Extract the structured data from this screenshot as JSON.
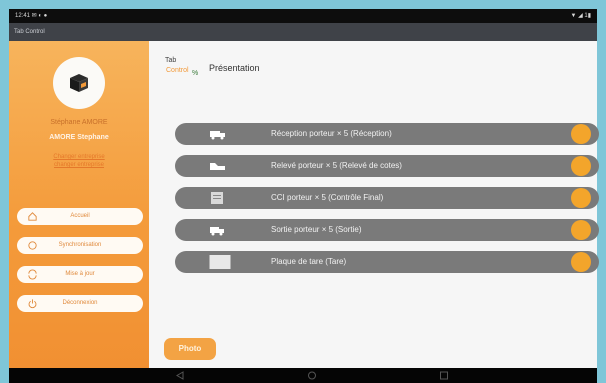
{
  "status_bar": {
    "left": "12:41 ✉ ◐ ●",
    "right": "▼ ◢ 1▮"
  },
  "app_title": "Tab Control",
  "sidebar": {
    "profile_lines": [
      "Stéphane AMORE",
      "AMORE Stephane",
      "Changer entreprise",
      "changer entreprise"
    ],
    "menu": [
      {
        "label": "Accueil",
        "icon": "home-icon"
      },
      {
        "label": "Synchronisation",
        "icon": "sync-icon"
      },
      {
        "label": "Mise à jour",
        "icon": "update-icon"
      },
      {
        "label": "Déconnexion",
        "icon": "power-icon"
      }
    ]
  },
  "header": {
    "brand_tab": "Tab",
    "brand_control": "Control",
    "brand_mark": "%",
    "title": "Présentation"
  },
  "tasks": [
    {
      "label": "Réception porteur × 5 (Réception)",
      "icon": "truck-icon"
    },
    {
      "label": "Relevé porteur × 5 (Relevé de cotes)",
      "icon": "truck-side-icon"
    },
    {
      "label": "CCI porteur × 5 (Contrôle Final)",
      "icon": "document-icon"
    },
    {
      "label": "Sortie porteur × 5 (Sortie)",
      "icon": "truck-exit-icon"
    },
    {
      "label": "Plaque de tare (Tare)",
      "icon": "plate-icon"
    }
  ],
  "photo_button": "Photo",
  "colors": {
    "accent": "#f3a52b",
    "sidebar": "#f49b3b",
    "row": "#7a7a7a"
  }
}
